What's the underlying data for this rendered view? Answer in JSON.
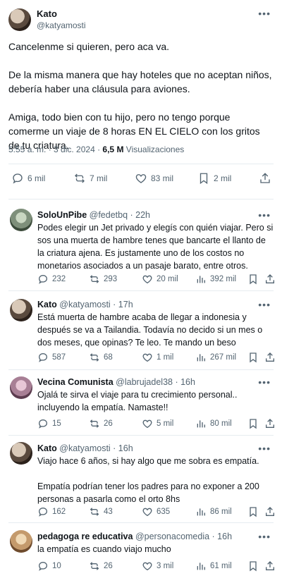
{
  "main_tweet": {
    "name": "Kato",
    "handle": "@katyamosti",
    "paragraphs": [
      "Cancelenme si quieren, pero aca va.",
      "De la misma manera que hay hoteles que no aceptan niños, debería haber una cláusula para aviones.",
      "Amiga, todo bien con tu hijo, pero no tengo porque comerme un viaje de 8 horas EN EL CIELO con los gritos de tu criatura."
    ],
    "time": "5:55 a. m. · 3 dic. 2024 ·",
    "views_count": "6,5 M",
    "views_label": "Visualizaciones",
    "replies": "6 mil",
    "reposts": "7 mil",
    "likes": "83 mil",
    "bookmarks": "2 mil"
  },
  "replies": [
    {
      "name": "SoloUnPibe",
      "handle": "@fedetbq · 22h",
      "text": "Podes elegir un Jet privado y elegís con quién viajar. Pero si sos una muerta de hambre tenes que bancarte el llanto de la criatura ajena. Es justamente uno de los costos no monetarios asociados a un pasaje barato, entre otros.",
      "replies": "232",
      "reposts": "293",
      "likes": "20 mil",
      "views": "392 mil"
    },
    {
      "name": "Kato",
      "handle": "@katyamosti · 17h",
      "text": "Está muerta de hambre acaba de llegar a indonesia y después se va a Tailandia. Todavía no decido si un mes o dos meses, que opinas? Te leo. Te mando un beso",
      "replies": "587",
      "reposts": "68",
      "likes": "1 mil",
      "views": "267 mil"
    },
    {
      "name": "Vecina Comunista",
      "handle": "@labrujadel38 · 16h",
      "text": "Ojalá te sirva el viaje para tu crecimiento personal.. incluyendo la empatía. Namaste!!",
      "replies": "15",
      "reposts": "26",
      "likes": "5 mil",
      "views": "80 mil"
    },
    {
      "name": "Kato",
      "handle": "@katyamosti · 16h",
      "text_p1": "Viajo hace 6 años, si hay algo que me sobra es empatía.",
      "text_p2": "Empatía podrían tener los padres para no exponer a 200 personas a pasarla como el orto 8hs",
      "replies": "162",
      "reposts": "43",
      "likes": "635",
      "views": "86 mil"
    },
    {
      "name": "pedagoga re educativa",
      "handle": "@personacomedia · 16h",
      "text": "la empatía es cuando viajo mucho",
      "replies": "10",
      "reposts": "26",
      "likes": "3 mil",
      "views": "61 mil"
    }
  ]
}
